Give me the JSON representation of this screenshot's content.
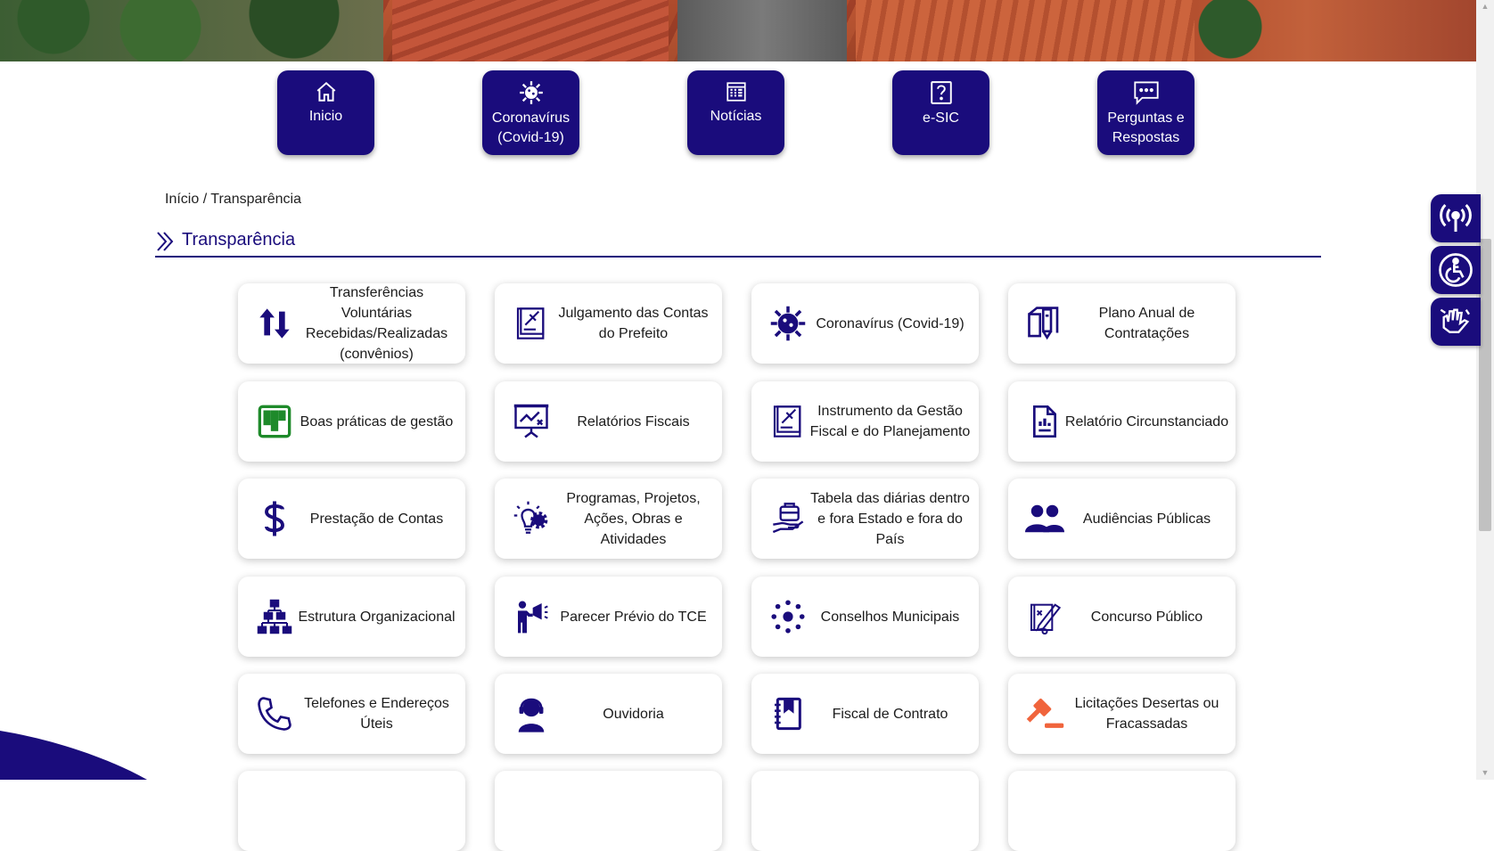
{
  "nav": [
    {
      "label": "Inicio",
      "icon": "home-icon"
    },
    {
      "label": "Coronavírus (Covid-19)",
      "icon": "virus-icon"
    },
    {
      "label": "Notícias",
      "icon": "newspaper-icon"
    },
    {
      "label": "e-SIC",
      "icon": "question-icon"
    },
    {
      "label": "Perguntas e Respostas",
      "icon": "chat-icon"
    }
  ],
  "breadcrumb": "Início / Transparência",
  "section_title": "Transparência",
  "cards": [
    {
      "label": "Transferências Voluntárias Recebidas/Realizadas (convênios)",
      "icon": "transfer-arrows-icon"
    },
    {
      "label": "Julgamento das Contas do Prefeito",
      "icon": "judgment-book-icon"
    },
    {
      "label": "Coronavírus (Covid-19)",
      "icon": "virus-icon"
    },
    {
      "label": "Plano Anual de Contratações",
      "icon": "plan-document-icon"
    },
    {
      "label": "Boas práticas de gestão",
      "icon": "kanban-board-icon"
    },
    {
      "label": "Relatórios Fiscais",
      "icon": "presentation-chart-icon"
    },
    {
      "label": "Instrumento da Gestão Fiscal e do Planejamento",
      "icon": "gavel-book-icon"
    },
    {
      "label": "Relatório Circunstanciado",
      "icon": "report-document-icon"
    },
    {
      "label": "Prestação de Contas",
      "icon": "dollar-icon"
    },
    {
      "label": "Programas, Projetos, Ações, Obras e Atividades",
      "icon": "idea-gear-icon"
    },
    {
      "label": "Tabela das diárias dentro e fora Estado e fora do País",
      "icon": "travel-briefcase-icon"
    },
    {
      "label": "Audiências Públicas",
      "icon": "users-icon"
    },
    {
      "label": "Estrutura Organizacional",
      "icon": "org-chart-icon"
    },
    {
      "label": "Parecer Prévio do TCE",
      "icon": "megaphone-person-icon"
    },
    {
      "label": "Conselhos Municipais",
      "icon": "council-network-icon"
    },
    {
      "label": "Concurso Público",
      "icon": "exam-pencil-icon"
    },
    {
      "label": "Telefones e Endereços Úteis",
      "icon": "phone-icon"
    },
    {
      "label": "Ouvidoria",
      "icon": "headset-agent-icon"
    },
    {
      "label": "Fiscal de Contrato",
      "icon": "bookmark-book-icon"
    },
    {
      "label": "Licitações Desertas ou Fracassadas",
      "icon": "auction-gavel-icon"
    }
  ],
  "side_tools": [
    {
      "icon": "broadcast-icon"
    },
    {
      "icon": "accessibility-icon"
    },
    {
      "icon": "sign-language-icon"
    }
  ],
  "colors": {
    "primary": "#1a0c7c",
    "green": "#1e8a2a",
    "orange": "#f0643c"
  }
}
